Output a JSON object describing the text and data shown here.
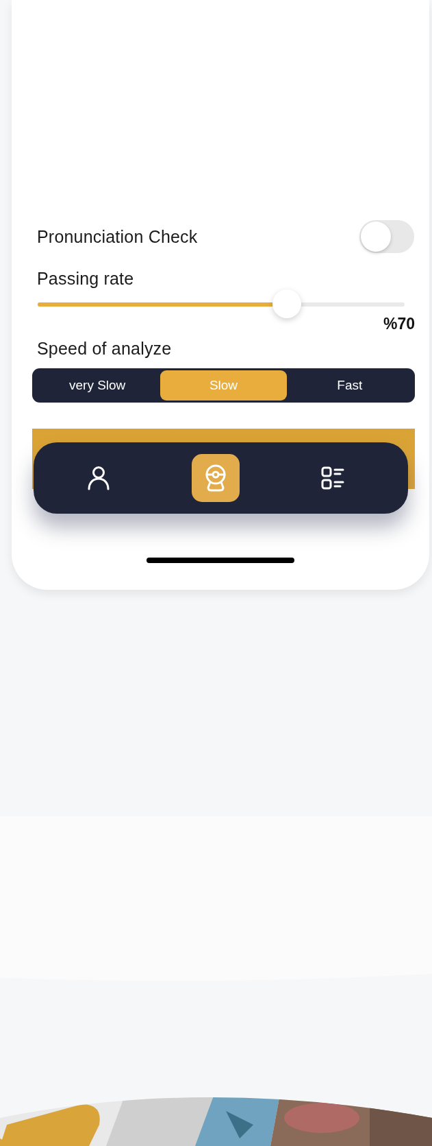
{
  "settings": {
    "pronunciation_check": {
      "label": "Pronunciation Check",
      "on": false
    },
    "passing_rate": {
      "label": "Passing rate",
      "level": 0.68,
      "reading": "%70"
    },
    "speed": {
      "label": "Speed of analyze",
      "options": [
        {
          "label": "very Slow",
          "selected": false
        },
        {
          "label": "Slow",
          "selected": true
        },
        {
          "label": "Fast",
          "selected": false
        }
      ]
    }
  },
  "nav": [
    {
      "kind": "profile",
      "selected": false
    },
    {
      "kind": "camera",
      "selected": true
    },
    {
      "kind": "list",
      "selected": false
    }
  ]
}
